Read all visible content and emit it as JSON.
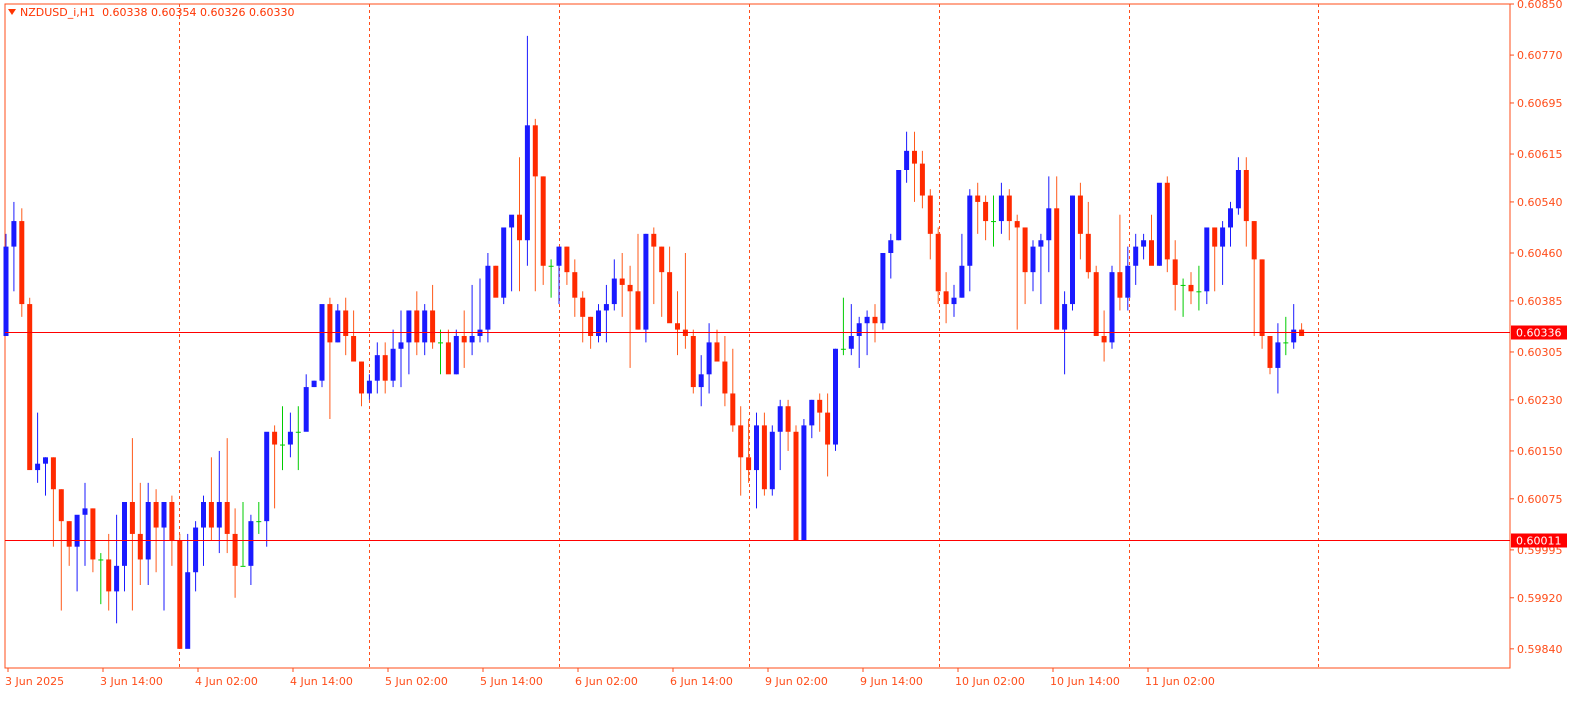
{
  "header": {
    "symbol_label": "NZDUSD_i,H1",
    "ohlc_text": "0.60338 0.60354 0.60326 0.60330"
  },
  "colors": {
    "bull": "#1a1aff",
    "bear": "#ff2a00",
    "wick_bull": "#1a1aff",
    "wick_bear": "#ff5a1a",
    "doji": "#00cc00",
    "grid": "#ff4d1a",
    "axis": "#ff4d1a",
    "hline": "#ff0000"
  },
  "chart_data": {
    "type": "candlestick",
    "symbol": "NZDUSD_i",
    "timeframe": "H1",
    "ylim": [
      0.5981,
      0.6085
    ],
    "y_ticks": [
      "0.60850",
      "0.60770",
      "0.60695",
      "0.60615",
      "0.60540",
      "0.60460",
      "0.60385",
      "0.60305",
      "0.60230",
      "0.60150",
      "0.60075",
      "0.59995",
      "0.59920",
      "0.59840"
    ],
    "x_ticks": [
      "3 Jun 2025",
      "3 Jun 14:00",
      "4 Jun 02:00",
      "4 Jun 14:00",
      "5 Jun 02:00",
      "5 Jun 14:00",
      "6 Jun 02:00",
      "6 Jun 14:00",
      "9 Jun 02:00",
      "9 Jun 14:00",
      "10 Jun 02:00",
      "10 Jun 14:00",
      "11 Jun 02:00"
    ],
    "horizontal_levels": [
      {
        "label": "0.60336",
        "value": 0.60336
      },
      {
        "label": "0.60011",
        "value": 0.60011
      }
    ],
    "grid": "vertical dashed",
    "ohlc": [
      [
        0.6033,
        0.6049,
        0.6033,
        0.6047
      ],
      [
        0.6047,
        0.6054,
        0.604,
        0.6051
      ],
      [
        0.6051,
        0.6053,
        0.6036,
        0.6038
      ],
      [
        0.6038,
        0.6039,
        0.6013,
        0.6012
      ],
      [
        0.6012,
        0.6021,
        0.601,
        0.6013
      ],
      [
        0.6013,
        0.6014,
        0.6008,
        0.6014
      ],
      [
        0.6014,
        0.6014,
        0.6,
        0.6009
      ],
      [
        0.6009,
        0.6009,
        0.599,
        0.6004
      ],
      [
        0.6004,
        0.6004,
        0.5997,
        0.6
      ],
      [
        0.6,
        0.6003,
        0.5993,
        0.6005
      ],
      [
        0.6005,
        0.601,
        0.5997,
        0.6006
      ],
      [
        0.6006,
        0.6006,
        0.5996,
        0.5998
      ],
      [
        0.5998,
        0.5999,
        0.5991,
        0.5998
      ],
      [
        0.5998,
        0.6002,
        0.599,
        0.5993
      ],
      [
        0.5993,
        0.6005,
        0.5988,
        0.5997
      ],
      [
        0.5997,
        0.6006,
        0.5993,
        0.6007
      ],
      [
        0.6007,
        0.6017,
        0.599,
        0.6002
      ],
      [
        0.6002,
        0.601,
        0.5994,
        0.5998
      ],
      [
        0.5998,
        0.601,
        0.5994,
        0.6007
      ],
      [
        0.6007,
        0.6009,
        0.5996,
        0.6003
      ],
      [
        0.6003,
        0.6006,
        0.599,
        0.6007
      ],
      [
        0.6007,
        0.6008,
        0.5997,
        0.6001
      ],
      [
        0.6001,
        0.6002,
        0.5984,
        0.5984
      ],
      [
        0.5984,
        0.6002,
        0.5986,
        0.5996
      ],
      [
        0.5996,
        0.6004,
        0.5993,
        0.6003
      ],
      [
        0.6003,
        0.6008,
        0.5997,
        0.6007
      ],
      [
        0.6007,
        0.6014,
        0.6001,
        0.6003
      ],
      [
        0.6003,
        0.6015,
        0.5999,
        0.6007
      ],
      [
        0.6007,
        0.6017,
        0.5999,
        0.6002
      ],
      [
        0.6002,
        0.6006,
        0.5992,
        0.5997
      ],
      [
        0.5997,
        0.6007,
        0.5997,
        0.5997
      ],
      [
        0.5997,
        0.6005,
        0.5994,
        0.6004
      ],
      [
        0.6004,
        0.6007,
        0.6002,
        0.6004
      ],
      [
        0.6004,
        0.6015,
        0.6,
        0.6018
      ],
      [
        0.6018,
        0.6019,
        0.6006,
        0.6016
      ],
      [
        0.6016,
        0.6022,
        0.6012,
        0.6016
      ],
      [
        0.6016,
        0.6021,
        0.6014,
        0.6018
      ],
      [
        0.6018,
        0.6022,
        0.6012,
        0.6018
      ],
      [
        0.6018,
        0.6027,
        0.602,
        0.6025
      ],
      [
        0.6025,
        0.6025,
        0.6026,
        0.6026
      ],
      [
        0.6026,
        0.6037,
        0.6025,
        0.6038
      ],
      [
        0.6038,
        0.6039,
        0.602,
        0.6032
      ],
      [
        0.6032,
        0.6038,
        0.6032,
        0.6037
      ],
      [
        0.6037,
        0.6039,
        0.603,
        0.6033
      ],
      [
        0.6033,
        0.6037,
        0.603,
        0.6029
      ],
      [
        0.6029,
        0.6029,
        0.6022,
        0.6024
      ],
      [
        0.6024,
        0.6027,
        0.6023,
        0.6026
      ],
      [
        0.6026,
        0.6032,
        0.6024,
        0.603
      ],
      [
        0.603,
        0.6032,
        0.6024,
        0.6026
      ],
      [
        0.6026,
        0.6034,
        0.6025,
        0.6031
      ],
      [
        0.6031,
        0.6037,
        0.6025,
        0.6032
      ],
      [
        0.6032,
        0.6037,
        0.6027,
        0.6037
      ],
      [
        0.6037,
        0.604,
        0.603,
        0.6032
      ],
      [
        0.6032,
        0.6038,
        0.603,
        0.6037
      ],
      [
        0.6037,
        0.6041,
        0.6031,
        0.6032
      ],
      [
        0.6032,
        0.6034,
        0.6027,
        0.6032
      ],
      [
        0.6032,
        0.6034,
        0.6029,
        0.6027
      ],
      [
        0.6027,
        0.6034,
        0.6027,
        0.6033
      ],
      [
        0.6033,
        0.6037,
        0.6028,
        0.6032
      ],
      [
        0.6032,
        0.6041,
        0.603,
        0.6033
      ],
      [
        0.6033,
        0.6042,
        0.6032,
        0.6034
      ],
      [
        0.6034,
        0.6046,
        0.6032,
        0.6044
      ],
      [
        0.6044,
        0.6044,
        0.604,
        0.6039
      ],
      [
        0.6039,
        0.6048,
        0.6038,
        0.605
      ],
      [
        0.605,
        0.6051,
        0.604,
        0.6052
      ],
      [
        0.6052,
        0.6061,
        0.604,
        0.6048
      ],
      [
        0.6048,
        0.608,
        0.6044,
        0.6066
      ],
      [
        0.6066,
        0.6067,
        0.604,
        0.6058
      ],
      [
        0.6058,
        0.6058,
        0.6041,
        0.6044
      ],
      [
        0.6044,
        0.6045,
        0.6039,
        0.6044
      ],
      [
        0.6044,
        0.6047,
        0.6038,
        0.6047
      ],
      [
        0.6047,
        0.6047,
        0.6041,
        0.6043
      ],
      [
        0.6043,
        0.6045,
        0.6036,
        0.6039
      ],
      [
        0.6039,
        0.604,
        0.6032,
        0.6036
      ],
      [
        0.6036,
        0.6036,
        0.6031,
        0.6033
      ],
      [
        0.6033,
        0.6038,
        0.6032,
        0.6037
      ],
      [
        0.6037,
        0.6041,
        0.6032,
        0.6038
      ],
      [
        0.6038,
        0.6045,
        0.6037,
        0.6042
      ],
      [
        0.6042,
        0.6046,
        0.6036,
        0.6041
      ],
      [
        0.6041,
        0.6044,
        0.6028,
        0.604
      ],
      [
        0.604,
        0.6049,
        0.6034,
        0.6034
      ],
      [
        0.6034,
        0.6049,
        0.6032,
        0.6049
      ],
      [
        0.6049,
        0.605,
        0.6038,
        0.6047
      ],
      [
        0.6047,
        0.6047,
        0.6036,
        0.6043
      ],
      [
        0.6043,
        0.6047,
        0.6037,
        0.6035
      ],
      [
        0.6035,
        0.604,
        0.603,
        0.6034
      ],
      [
        0.6034,
        0.6046,
        0.6031,
        0.6033
      ],
      [
        0.6033,
        0.6034,
        0.6024,
        0.6025
      ],
      [
        0.6025,
        0.603,
        0.6022,
        0.6027
      ],
      [
        0.6027,
        0.6035,
        0.6024,
        0.6032
      ],
      [
        0.6032,
        0.6034,
        0.6029,
        0.6029
      ],
      [
        0.6029,
        0.6033,
        0.6022,
        0.6024
      ],
      [
        0.6024,
        0.6031,
        0.6018,
        0.6019
      ],
      [
        0.6019,
        0.6022,
        0.6008,
        0.6014
      ],
      [
        0.6014,
        0.602,
        0.601,
        0.6012
      ],
      [
        0.6012,
        0.6021,
        0.6006,
        0.6019
      ],
      [
        0.6019,
        0.6021,
        0.6008,
        0.6009
      ],
      [
        0.6009,
        0.6019,
        0.6008,
        0.6018
      ],
      [
        0.6018,
        0.6023,
        0.6012,
        0.6022
      ],
      [
        0.6022,
        0.6023,
        0.6015,
        0.6018
      ],
      [
        0.6018,
        0.6019,
        0.6001,
        0.6001
      ],
      [
        0.6001,
        0.602,
        0.6001,
        0.6019
      ],
      [
        0.6019,
        0.6023,
        0.6017,
        0.6023
      ],
      [
        0.6023,
        0.6024,
        0.6018,
        0.6021
      ],
      [
        0.6021,
        0.6024,
        0.6011,
        0.6016
      ],
      [
        0.6016,
        0.6031,
        0.6015,
        0.6031
      ],
      [
        0.6031,
        0.6039,
        0.603,
        0.6031
      ],
      [
        0.6031,
        0.6038,
        0.603,
        0.6033
      ],
      [
        0.6033,
        0.6036,
        0.6028,
        0.6035
      ],
      [
        0.6035,
        0.6037,
        0.603,
        0.6036
      ],
      [
        0.6036,
        0.6038,
        0.6032,
        0.6035
      ],
      [
        0.6035,
        0.6046,
        0.6034,
        0.6046
      ],
      [
        0.6046,
        0.6049,
        0.6042,
        0.6048
      ],
      [
        0.6048,
        0.6059,
        0.6048,
        0.6059
      ],
      [
        0.6059,
        0.6065,
        0.6057,
        0.6062
      ],
      [
        0.6062,
        0.6065,
        0.6054,
        0.606
      ],
      [
        0.606,
        0.6062,
        0.6053,
        0.6055
      ],
      [
        0.6055,
        0.6056,
        0.6045,
        0.6049
      ],
      [
        0.6049,
        0.605,
        0.6038,
        0.604
      ],
      [
        0.604,
        0.6043,
        0.6035,
        0.6038
      ],
      [
        0.6038,
        0.6041,
        0.6036,
        0.6039
      ],
      [
        0.6039,
        0.6049,
        0.6039,
        0.6044
      ],
      [
        0.6044,
        0.6056,
        0.604,
        0.6055
      ],
      [
        0.6055,
        0.6057,
        0.6049,
        0.6054
      ],
      [
        0.6054,
        0.6055,
        0.6048,
        0.6051
      ],
      [
        0.6051,
        0.6055,
        0.6047,
        0.6051
      ],
      [
        0.6051,
        0.6057,
        0.6049,
        0.6055
      ],
      [
        0.6055,
        0.6056,
        0.6048,
        0.6051
      ],
      [
        0.6051,
        0.6052,
        0.6034,
        0.605
      ],
      [
        0.605,
        0.605,
        0.6038,
        0.6043
      ],
      [
        0.6043,
        0.6048,
        0.604,
        0.6047
      ],
      [
        0.6047,
        0.6049,
        0.6038,
        0.6048
      ],
      [
        0.6048,
        0.6058,
        0.6043,
        0.6053
      ],
      [
        0.6053,
        0.6058,
        0.6039,
        0.6034
      ],
      [
        0.6034,
        0.604,
        0.6027,
        0.6038
      ],
      [
        0.6038,
        0.6055,
        0.6037,
        0.6055
      ],
      [
        0.6055,
        0.6057,
        0.6045,
        0.6049
      ],
      [
        0.6049,
        0.6054,
        0.6042,
        0.6043
      ],
      [
        0.6043,
        0.6044,
        0.6033,
        0.6033
      ],
      [
        0.6033,
        0.6037,
        0.6029,
        0.6032
      ],
      [
        0.6032,
        0.6044,
        0.6031,
        0.6043
      ],
      [
        0.6043,
        0.6052,
        0.6037,
        0.6039
      ],
      [
        0.6039,
        0.6047,
        0.6037,
        0.6044
      ],
      [
        0.6044,
        0.6049,
        0.6041,
        0.6047
      ],
      [
        0.6047,
        0.6049,
        0.6045,
        0.6048
      ],
      [
        0.6048,
        0.6052,
        0.6046,
        0.6044
      ],
      [
        0.6044,
        0.6056,
        0.6044,
        0.6057
      ],
      [
        0.6057,
        0.6058,
        0.6043,
        0.6045
      ],
      [
        0.6045,
        0.6048,
        0.6037,
        0.6041
      ],
      [
        0.6041,
        0.6042,
        0.6036,
        0.6041
      ],
      [
        0.6041,
        0.6043,
        0.6038,
        0.604
      ],
      [
        0.604,
        0.6044,
        0.6037,
        0.604
      ],
      [
        0.604,
        0.6045,
        0.6038,
        0.605
      ],
      [
        0.605,
        0.605,
        0.604,
        0.6047
      ],
      [
        0.6047,
        0.6051,
        0.6041,
        0.605
      ],
      [
        0.605,
        0.6054,
        0.6047,
        0.6053
      ],
      [
        0.6053,
        0.6061,
        0.6052,
        0.6059
      ],
      [
        0.6059,
        0.6061,
        0.6047,
        0.6051
      ],
      [
        0.6051,
        0.6051,
        0.6033,
        0.6045
      ],
      [
        0.6045,
        0.6045,
        0.6031,
        0.6033
      ],
      [
        0.6033,
        0.6033,
        0.6027,
        0.6028
      ],
      [
        0.6028,
        0.6035,
        0.6024,
        0.6032
      ],
      [
        0.6032,
        0.6036,
        0.603,
        0.6032
      ],
      [
        0.6032,
        0.6038,
        0.6031,
        0.6034
      ],
      [
        0.6034,
        0.6035,
        0.6033,
        0.6033
      ]
    ]
  }
}
